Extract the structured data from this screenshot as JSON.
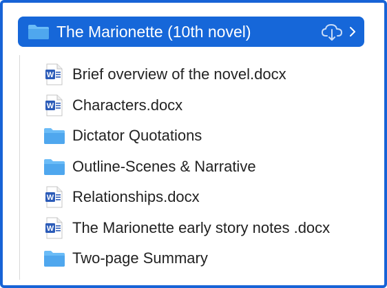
{
  "header": {
    "title": "The Marionette (10th novel)",
    "icon": "folder-icon",
    "cloud_icon": "cloud-download-icon",
    "chevron_icon": "chevron-right-icon"
  },
  "colors": {
    "frame_border": "#1763d6",
    "header_bg": "#1667d9",
    "folder_blue": "#4fa7ee",
    "word_blue": "#2b5bb8",
    "text": "#222222"
  },
  "items": [
    {
      "label": "Brief overview of the novel.docx",
      "type": "word-document",
      "icon": "word-document-icon"
    },
    {
      "label": "Characters.docx",
      "type": "word-document",
      "icon": "word-document-icon"
    },
    {
      "label": "Dictator Quotations",
      "type": "folder",
      "icon": "folder-icon"
    },
    {
      "label": "Outline-Scenes & Narrative",
      "type": "folder",
      "icon": "folder-icon"
    },
    {
      "label": "Relationships.docx",
      "type": "word-document",
      "icon": "word-document-icon"
    },
    {
      "label": "The Marionette early story notes .docx",
      "type": "word-document",
      "icon": "word-document-icon"
    },
    {
      "label": "Two-page Summary",
      "type": "folder",
      "icon": "folder-icon"
    }
  ]
}
